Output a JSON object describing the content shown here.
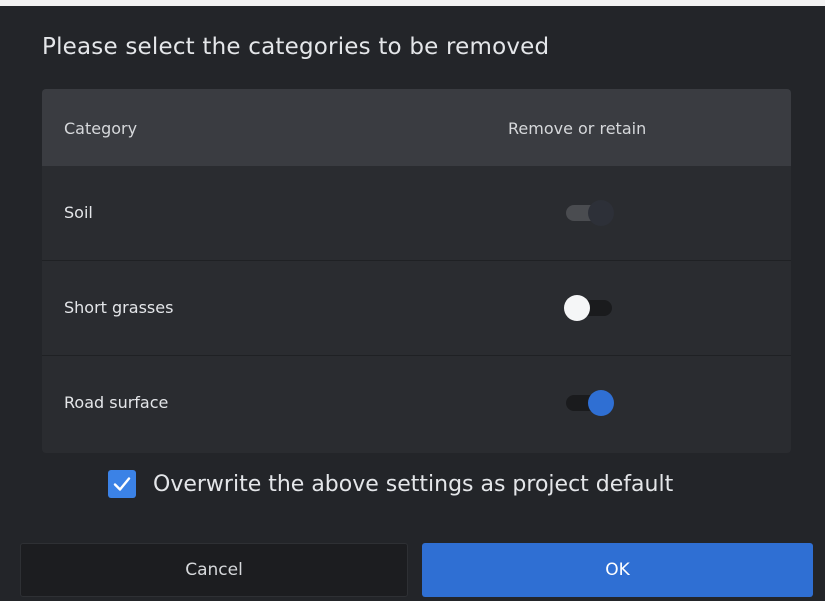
{
  "dialog": {
    "title": "Please select the categories to be removed"
  },
  "table": {
    "headers": {
      "category": "Category",
      "action": "Remove or retain"
    },
    "rows": [
      {
        "label": "Soil",
        "toggle_state": "disabled"
      },
      {
        "label": "Short grasses",
        "toggle_state": "off"
      },
      {
        "label": "Road surface",
        "toggle_state": "on"
      }
    ]
  },
  "checkbox": {
    "label": "Overwrite the above settings as project default",
    "checked": true,
    "icon": "check-icon"
  },
  "buttons": {
    "cancel": "Cancel",
    "ok": "OK"
  },
  "colors": {
    "accent": "#2f6fd3",
    "dialog_bg": "#232529",
    "header_bg": "#3a3c41"
  }
}
